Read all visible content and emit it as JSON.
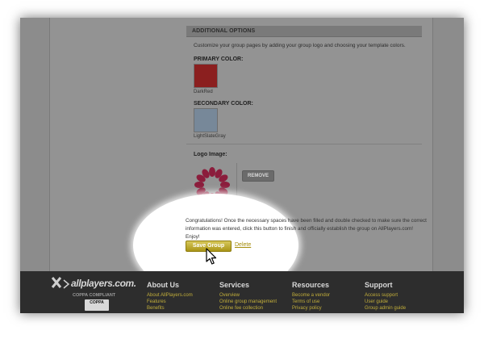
{
  "options": {
    "section_title": "ADDITIONAL OPTIONS",
    "help_text": "Customize your group pages by adding your group logo and choosing your template colors.",
    "primary_label": "PRIMARY COLOR:",
    "primary_color": "#8b1f1f",
    "primary_name": "DarkRed",
    "secondary_label": "SECONDARY COLOR:",
    "secondary_color": "#778899",
    "secondary_name": "LightSlateGray",
    "logo_label": "Logo Image:",
    "remove_label": "REMOVE"
  },
  "submit": {
    "congrats_text": "Congratulations! Once the necessary spaces have been filled and double checked to make sure the correct information was entered, click this button to finish and officially establish the group on AllPlayers.com! Enjoy!",
    "save_label": "Save Group",
    "delete_label": "Delete"
  },
  "footer": {
    "brand": "allplayers.com.",
    "coppa": "COPPA COMPLIANT",
    "coppa_badge": "COPPA",
    "columns": [
      {
        "title": "About Us",
        "links": [
          "About AllPlayers.com",
          "Features",
          "Benefits"
        ]
      },
      {
        "title": "Services",
        "links": [
          "Overview",
          "Online group management",
          "Online fee collection"
        ]
      },
      {
        "title": "Resources",
        "links": [
          "Become a vendor",
          "Terms of use",
          "Privacy policy"
        ]
      },
      {
        "title": "Support",
        "links": [
          "Access support",
          "User guide",
          "Group admin guide"
        ]
      }
    ]
  }
}
